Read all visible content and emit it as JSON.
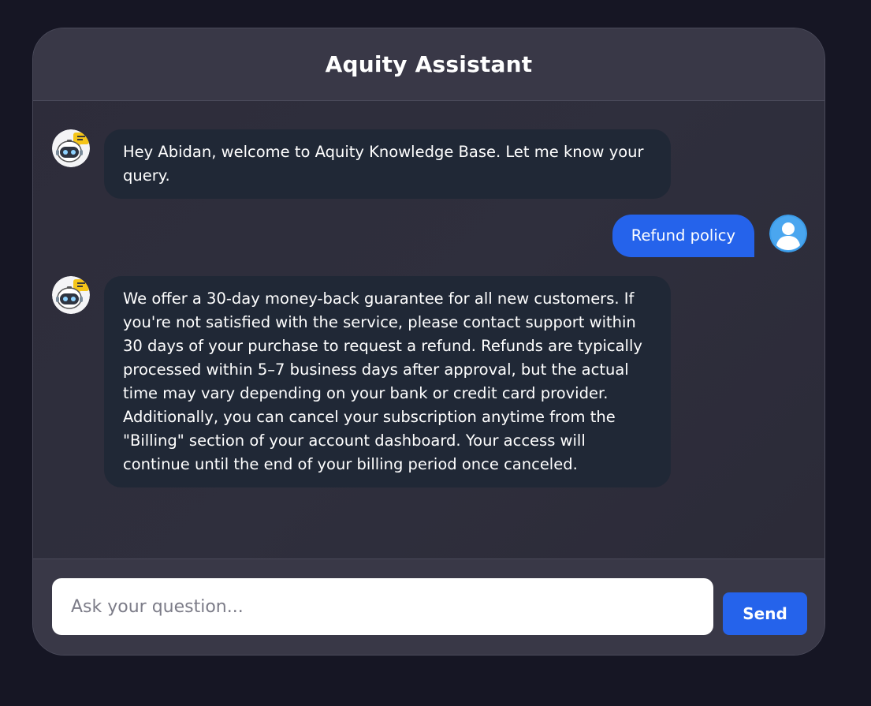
{
  "header": {
    "title": "Aquity Assistant"
  },
  "messages": [
    {
      "role": "assistant",
      "avatar_icon": "robot-icon",
      "text": "Hey Abidan, welcome to Aquity Knowledge Base. Let me know your query."
    },
    {
      "role": "user",
      "avatar_icon": "user-avatar-icon",
      "text": "Refund policy"
    },
    {
      "role": "assistant",
      "avatar_icon": "robot-icon",
      "text": "We offer a 30-day money-back guarantee for all new customers. If you're not satisfied with the service, please contact support within 30 days of your purchase to request a refund. Refunds are typically processed within 5–7 business days after approval, but the actual time may vary depending on your bank or credit card provider. Additionally, you can cancel your subscription anytime from the \"Billing\" section of your account dashboard. Your access will continue until the end of your billing period once canceled."
    }
  ],
  "composer": {
    "placeholder": "Ask your question...",
    "value": "",
    "send_label": "Send"
  },
  "colors": {
    "page_background": "#161624",
    "panel_background": "#2d2c3a",
    "header_background": "#393847",
    "bot_bubble": "#202836",
    "accent": "#2563eb",
    "text": "#ffffff"
  }
}
